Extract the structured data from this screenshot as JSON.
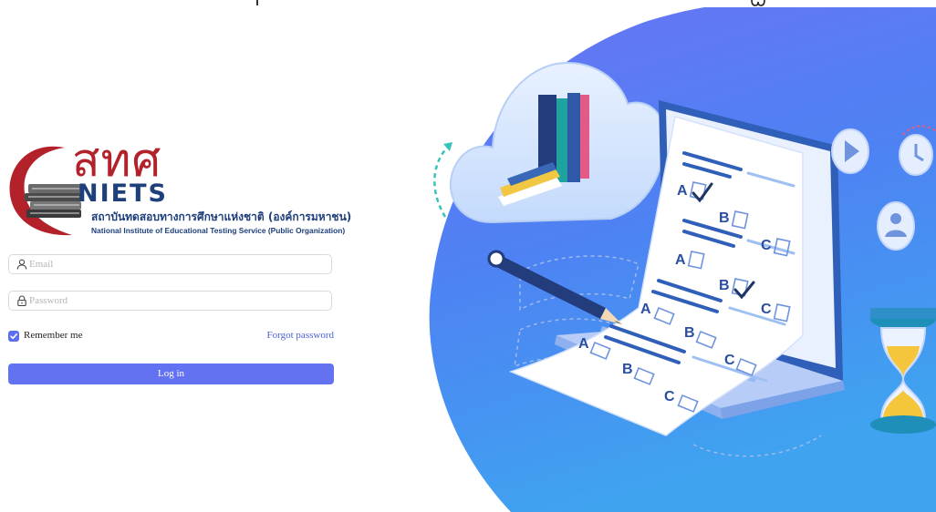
{
  "logo": {
    "thai_abbr": "สทศ",
    "abbr": "NIETS",
    "thai_name": "สถาบันทดสอบทางการศึกษาแห่งชาติ (องค์การมหาชน)",
    "english_name": "National Institute of Educational Testing Service (Public Organization)"
  },
  "form": {
    "email_placeholder": "Email",
    "email_value": "",
    "password_placeholder": "Password",
    "password_value": "",
    "remember_label": "Remember me",
    "remember_checked": true,
    "forgot_label": "Forgot password",
    "login_label": "Log in"
  },
  "icons": {
    "email": "user-icon",
    "password": "lock-icon",
    "checkbox": "check-icon"
  },
  "colors": {
    "primary": "#6272f0",
    "link": "#4a5fd8",
    "brand_red": "#b3212b",
    "brand_navy": "#1d3f7a",
    "illustration_blue": "#4d6ff2"
  },
  "illustration": {
    "answer_letters": [
      "A",
      "B",
      "C",
      "A",
      "B",
      "C",
      "A",
      "B",
      "C",
      "A",
      "B",
      "C"
    ]
  }
}
